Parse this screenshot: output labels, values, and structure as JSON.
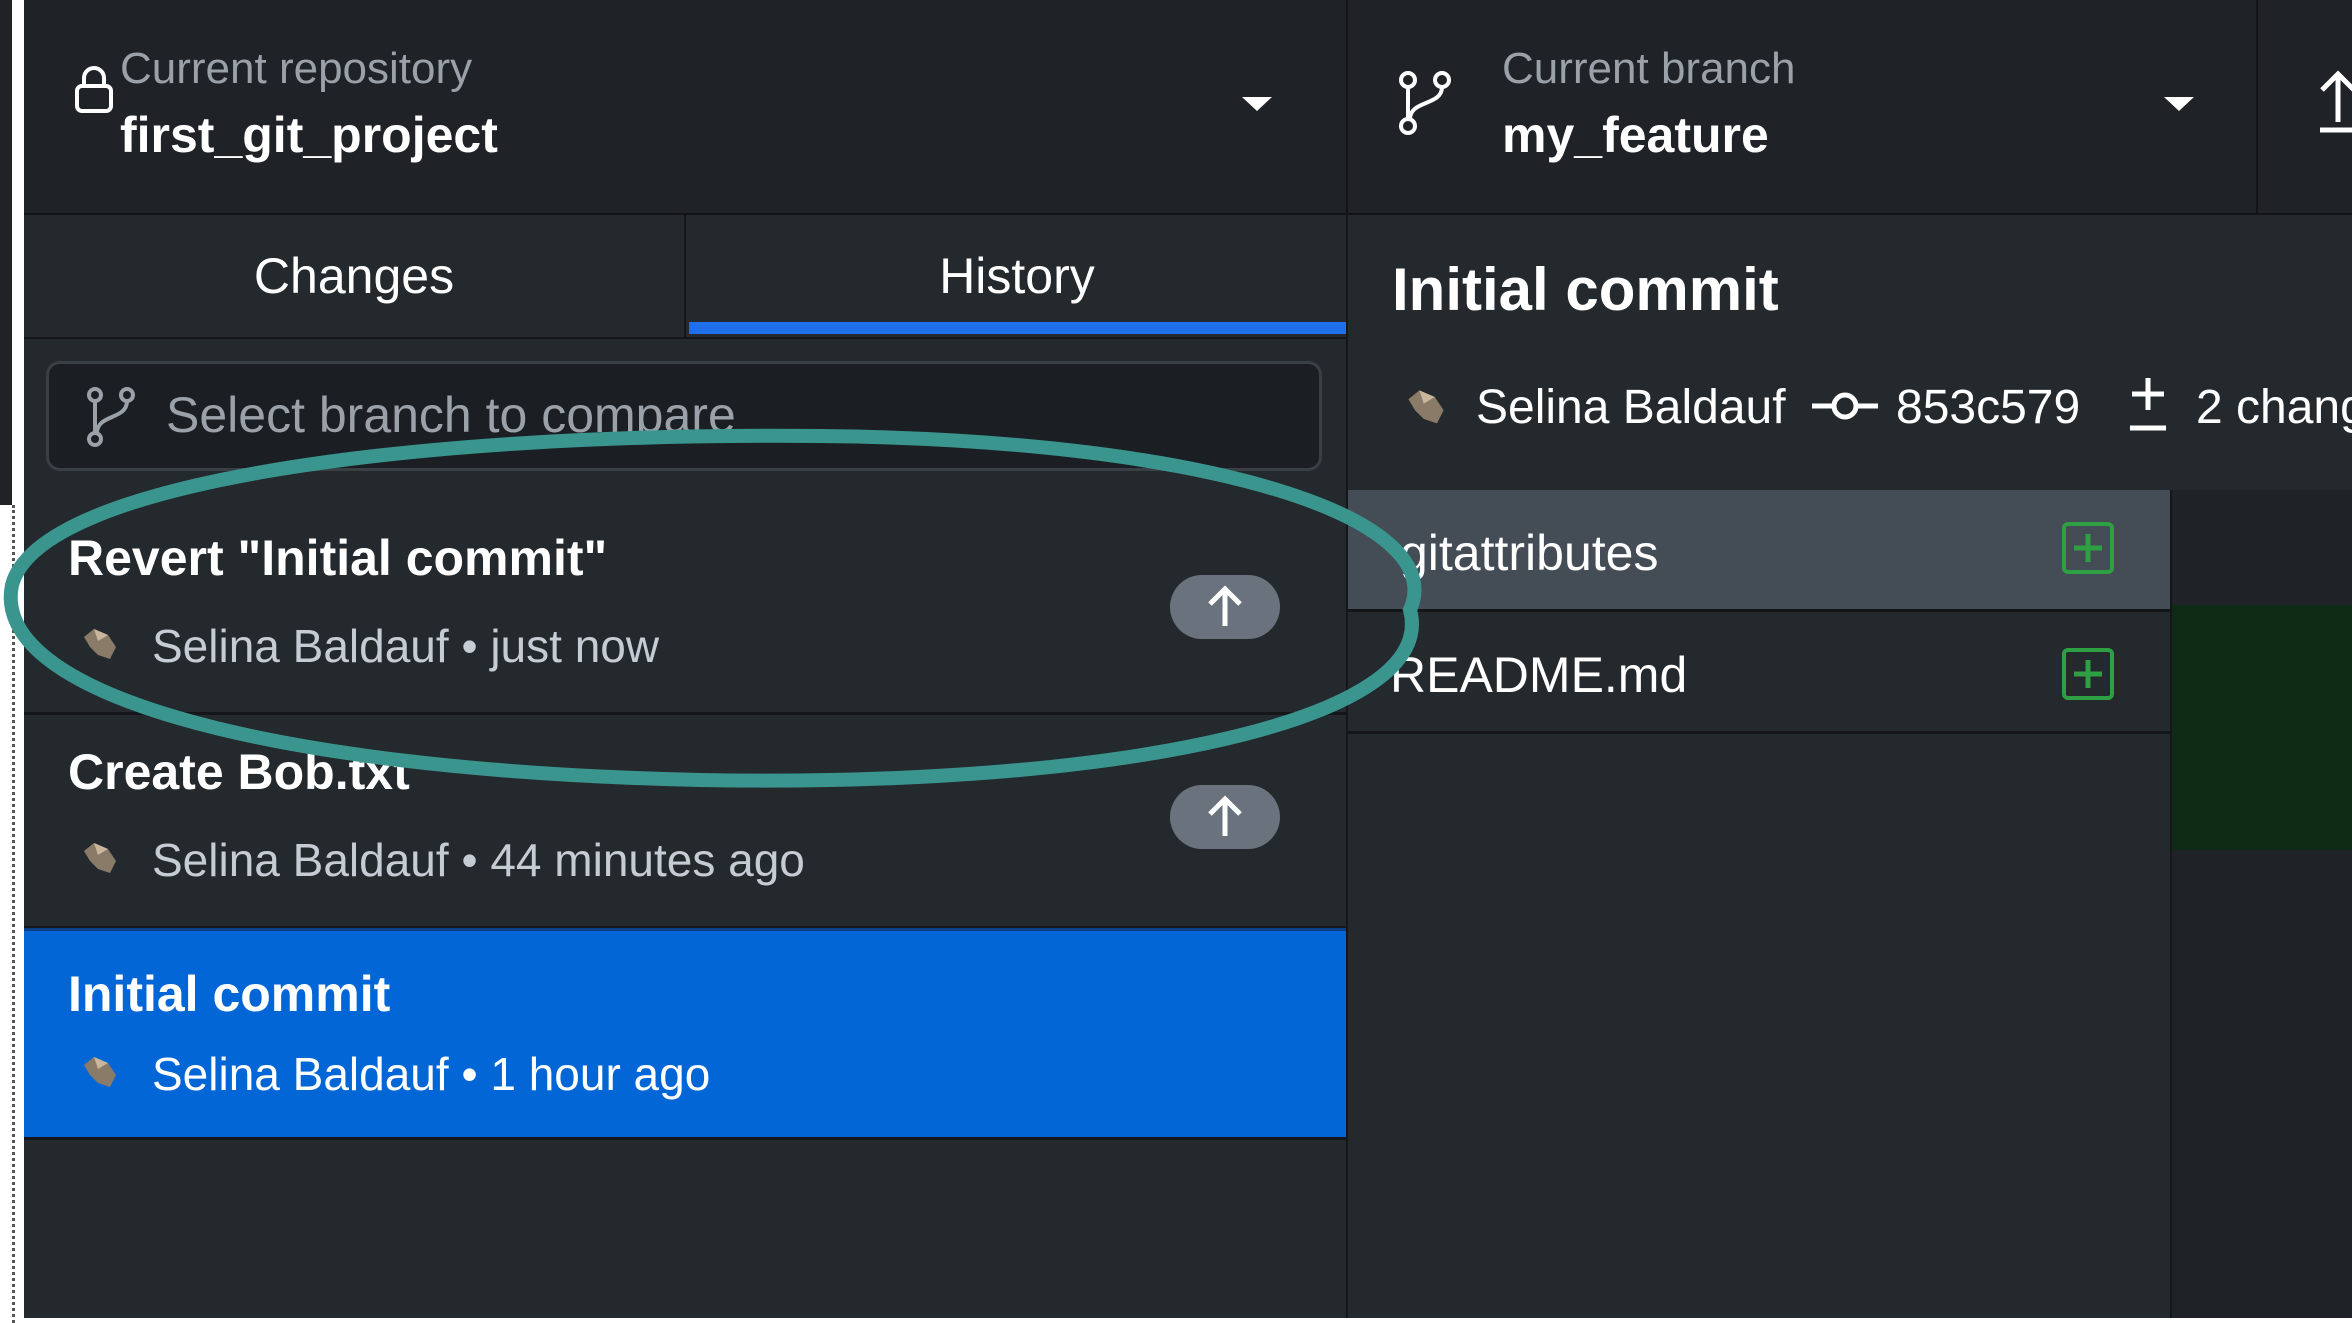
{
  "toolbar": {
    "repository": {
      "label": "Current repository",
      "value": "first_git_project"
    },
    "branch": {
      "label": "Current branch",
      "value": "my_feature"
    }
  },
  "tabs": [
    {
      "label": "Changes",
      "active": false
    },
    {
      "label": "History",
      "active": true
    }
  ],
  "compare": {
    "placeholder": "Select branch to compare"
  },
  "commits": [
    {
      "title": "Revert \"Initial commit\"",
      "author": "Selina Baldauf",
      "time": "just now",
      "meta": "Selina Baldauf • just now",
      "unpushed": true,
      "selected": false
    },
    {
      "title": "Create Bob.txt",
      "author": "Selina Baldauf",
      "time": "44 minutes ago",
      "meta": "Selina Baldauf • 44 minutes ago",
      "unpushed": true,
      "selected": false
    },
    {
      "title": "Initial commit",
      "author": "Selina Baldauf",
      "time": "1 hour ago",
      "meta": "Selina Baldauf • 1 hour ago",
      "unpushed": false,
      "selected": true
    }
  ],
  "details": {
    "title": "Initial commit",
    "author": "Selina Baldauf",
    "sha": "853c579",
    "changes": "2 chang"
  },
  "files": [
    {
      "name": "gitattributes",
      "status": "added",
      "selected": true
    },
    {
      "name": "README.md",
      "status": "added",
      "selected": false
    }
  ],
  "icons": {
    "repository": "lock-icon",
    "branch": "git-branch-icon",
    "dropdown": "caret-down-icon",
    "push": "arrow-up-icon",
    "avatar": "user-avatar-icon",
    "commit": "git-commit-icon",
    "diff": "diff-icon",
    "added": "file-added-icon"
  },
  "colors": {
    "accent": "#1f6feb",
    "selected": "#0366d6",
    "annotation": "#3a958f",
    "added": "#2ea043"
  }
}
